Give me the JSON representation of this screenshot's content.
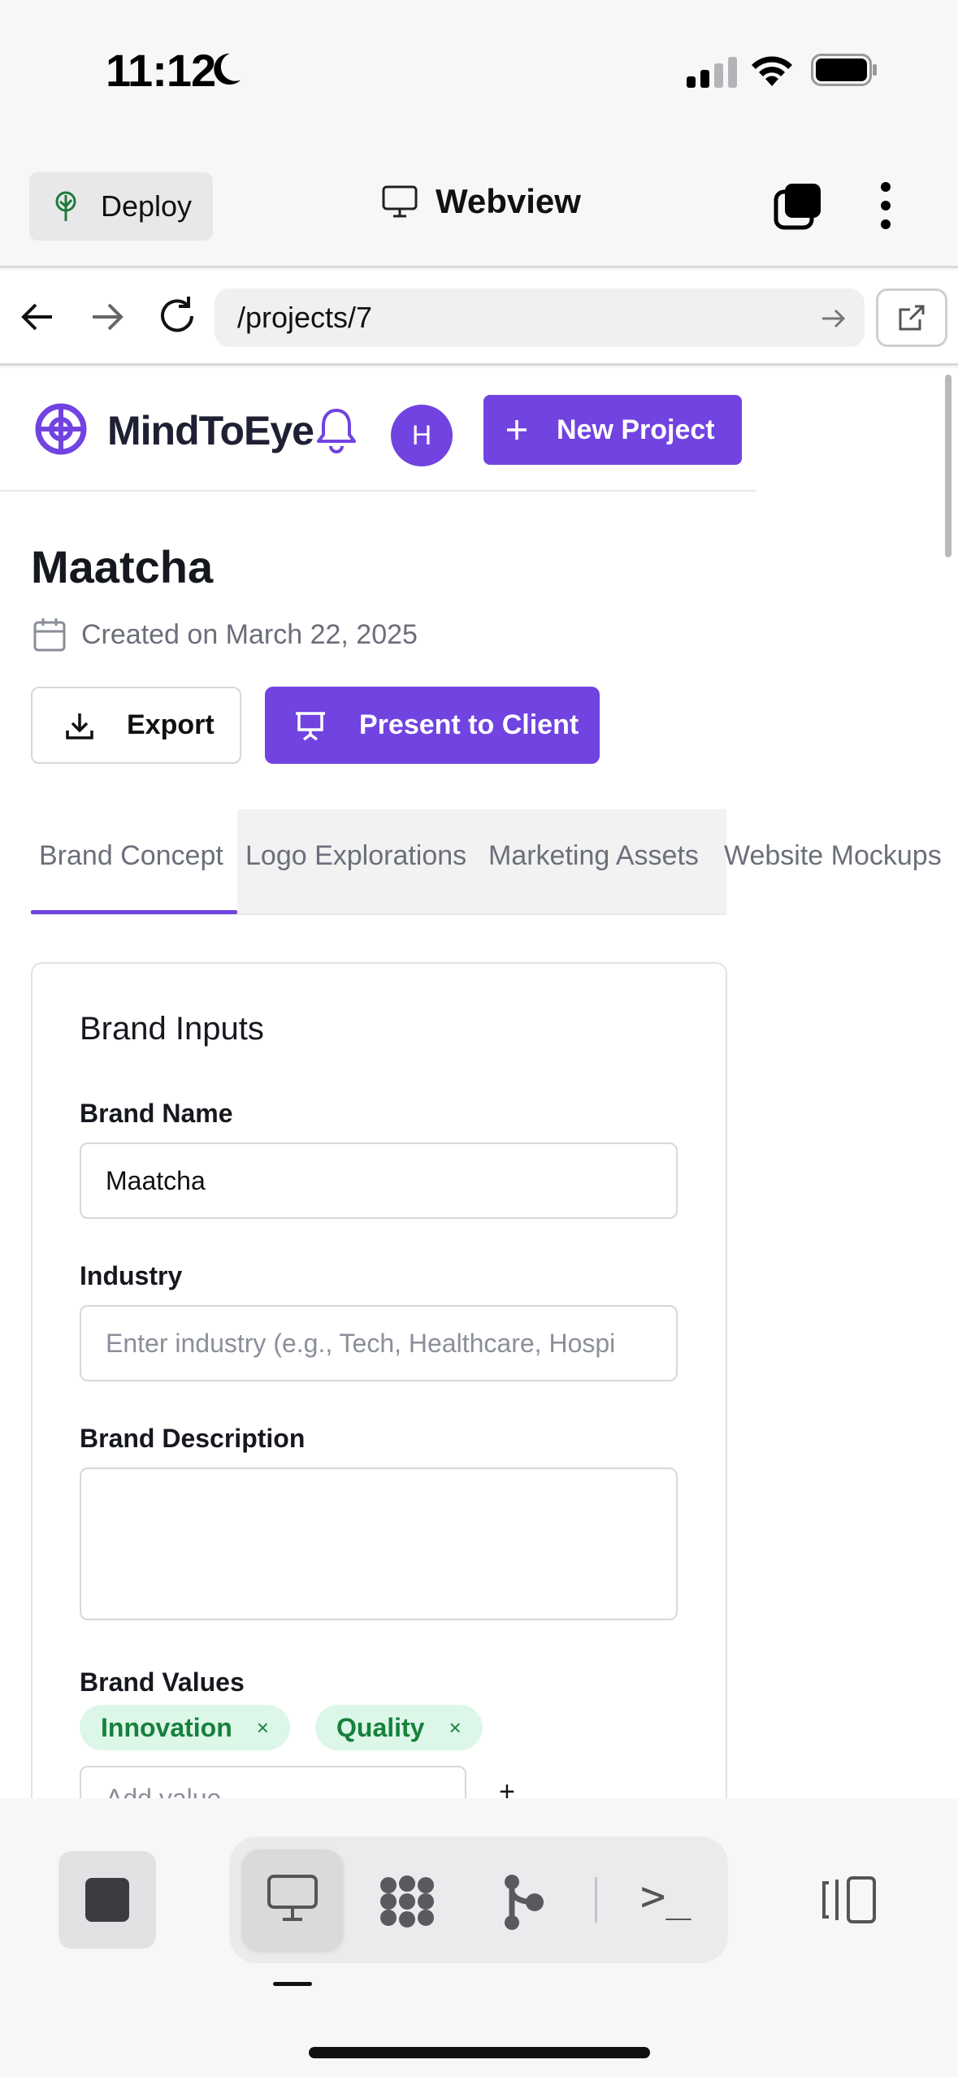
{
  "status": {
    "time": "11:12"
  },
  "header": {
    "deploy_label": "Deploy",
    "title": "Webview"
  },
  "url": {
    "value": "/projects/7"
  },
  "site": {
    "brand": "MindToEye",
    "avatar_initial": "H",
    "new_project_label": "New Project"
  },
  "project": {
    "title": "Maatcha",
    "created": "Created on March 22, 2025",
    "export_label": "Export",
    "present_label": "Present to Client"
  },
  "tabs": [
    {
      "label": "Brand Concept",
      "active": true
    },
    {
      "label": "Logo Explorations",
      "active": false
    },
    {
      "label": "Marketing Assets",
      "active": false
    },
    {
      "label": "Website Mockups",
      "active": false
    }
  ],
  "form": {
    "card_title": "Brand Inputs",
    "brand_name_label": "Brand Name",
    "brand_name_value": "Maatcha",
    "industry_label": "Industry",
    "industry_placeholder": "Enter industry (e.g., Tech, Healthcare, Hospi",
    "description_label": "Brand Description",
    "values_label": "Brand Values",
    "values": [
      {
        "label": "Innovation",
        "remove": "×"
      },
      {
        "label": "Quality",
        "remove": "×"
      }
    ],
    "add_value_placeholder": "Add value",
    "add_value_plus": "+"
  },
  "colors": {
    "accent": "#7143e0",
    "tag_bg": "#dcf7e7",
    "tag_text": "#17803d"
  },
  "toolbar": {
    "icons": [
      "stop-icon",
      "monitor-icon",
      "agents-icon",
      "branch-icon",
      "terminal-icon",
      "panel-toggle-icon"
    ],
    "terminal_glyph": ">_"
  }
}
